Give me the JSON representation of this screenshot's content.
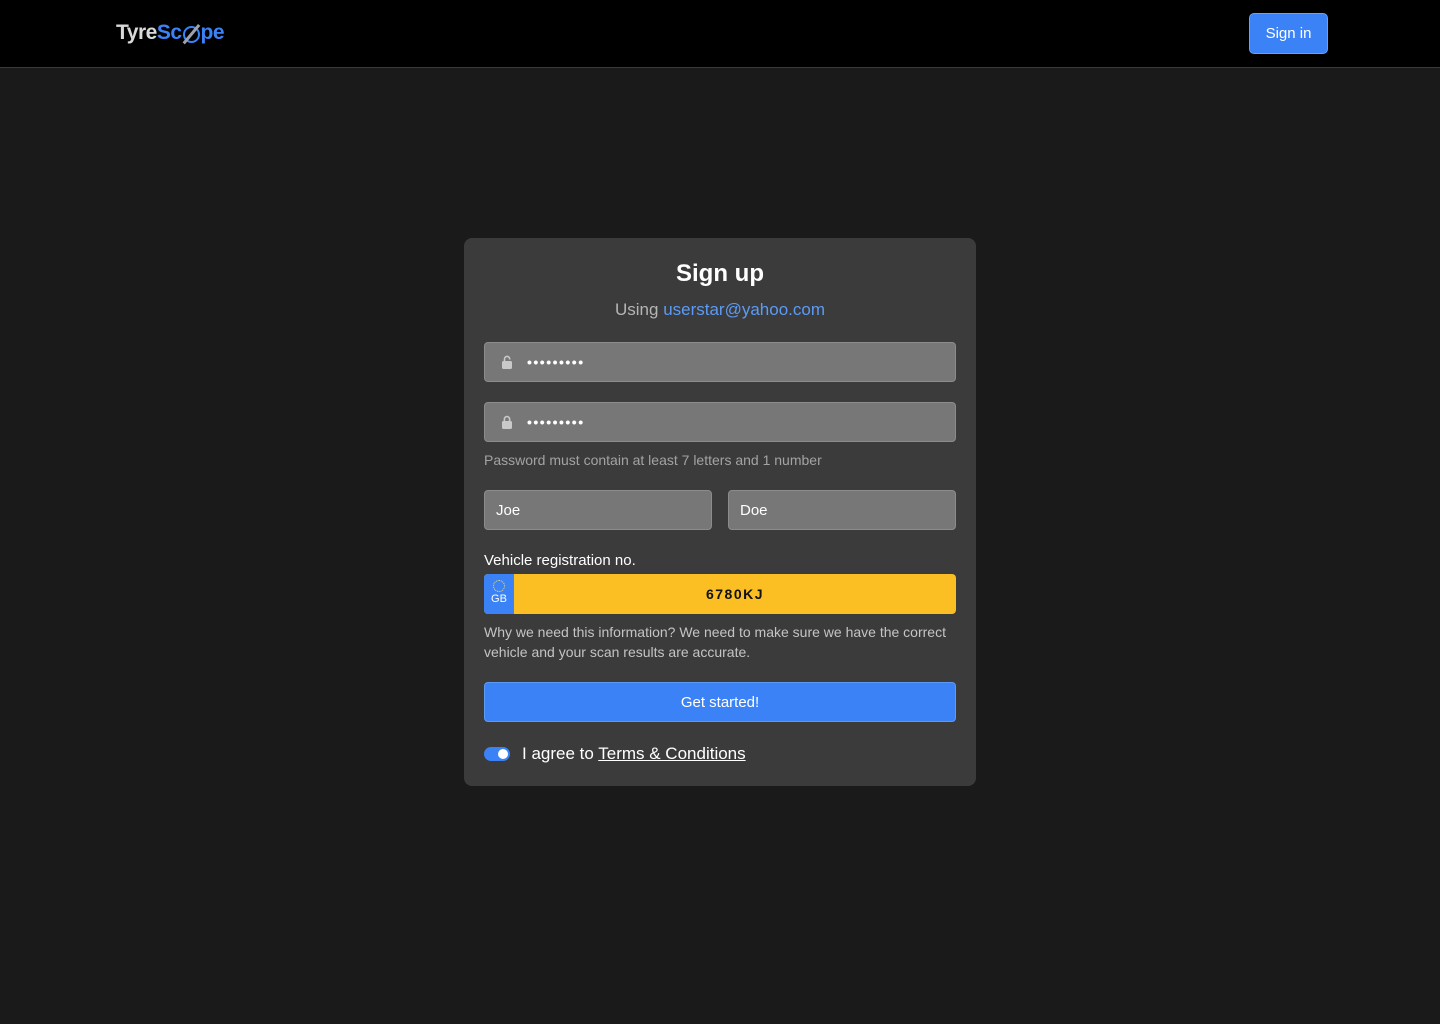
{
  "header": {
    "logo_part1": "Tyre",
    "logo_part2": "Sc",
    "logo_part3": "pe",
    "signin_label": "Sign in"
  },
  "form": {
    "title": "Sign up",
    "using_label": "Using",
    "email": "userstar@yahoo.com",
    "password_value": "•••••••••",
    "confirm_password_value": "•••••••••",
    "password_hint": "Password must contain at least 7 letters and 1 number",
    "first_name": "Joe",
    "last_name": "Doe",
    "registration_label": "Vehicle registration no.",
    "plate_country": "GB",
    "plate_number": "6780KJ",
    "info_text": "Why we need this information? We need to make sure we have the correct vehicle and your scan results are accurate.",
    "submit_label": "Get started!",
    "agree_text": "I agree to",
    "terms_link": "Terms & Conditions",
    "terms_agreed": true
  },
  "icons": {
    "password": "unlocked-padlock-icon",
    "confirm_password": "locked-padlock-icon",
    "plate_flag": "eu-stars-icon",
    "toggle": "toggle-switch-icon"
  },
  "colors": {
    "accent": "#3b82f6",
    "plate": "#fbbf24",
    "card": "#3b3b3b",
    "page_bg": "#1a1a1a"
  }
}
